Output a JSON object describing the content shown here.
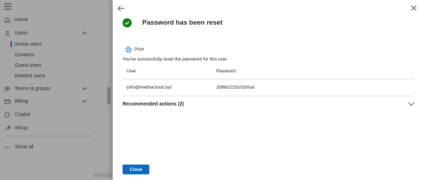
{
  "nav": {
    "items": [
      {
        "label": "Home",
        "icon": "home-icon"
      },
      {
        "label": "Users",
        "icon": "user-icon"
      },
      {
        "label": "Teams & groups",
        "icon": "teams-icon"
      },
      {
        "label": "Billing",
        "icon": "credit-card-icon"
      },
      {
        "label": "Copilot",
        "icon": "copilot-icon"
      },
      {
        "label": "Setup",
        "icon": "wrench-icon"
      },
      {
        "label": "Show all",
        "icon": "ellipsis-icon"
      }
    ],
    "users_sub": [
      "Active users",
      "Contacts",
      "Guest users",
      "Deleted users"
    ],
    "active_sub": "Active users"
  },
  "panel": {
    "title": "Password has been reset",
    "print_label": "Print",
    "message": "You've successfully reset the password for this user.",
    "table": {
      "headers": [
        "User",
        "Password"
      ],
      "rows": [
        [
          "john@medhacloud.xyz",
          "J(968222310320ud"
        ]
      ]
    },
    "recommended_label": "Recommended actions (2)",
    "close_label": "Close"
  },
  "colors": {
    "accent": "#0f6cbd",
    "success": "#107c10",
    "overlay": "rgba(60,60,60,0.45)"
  }
}
